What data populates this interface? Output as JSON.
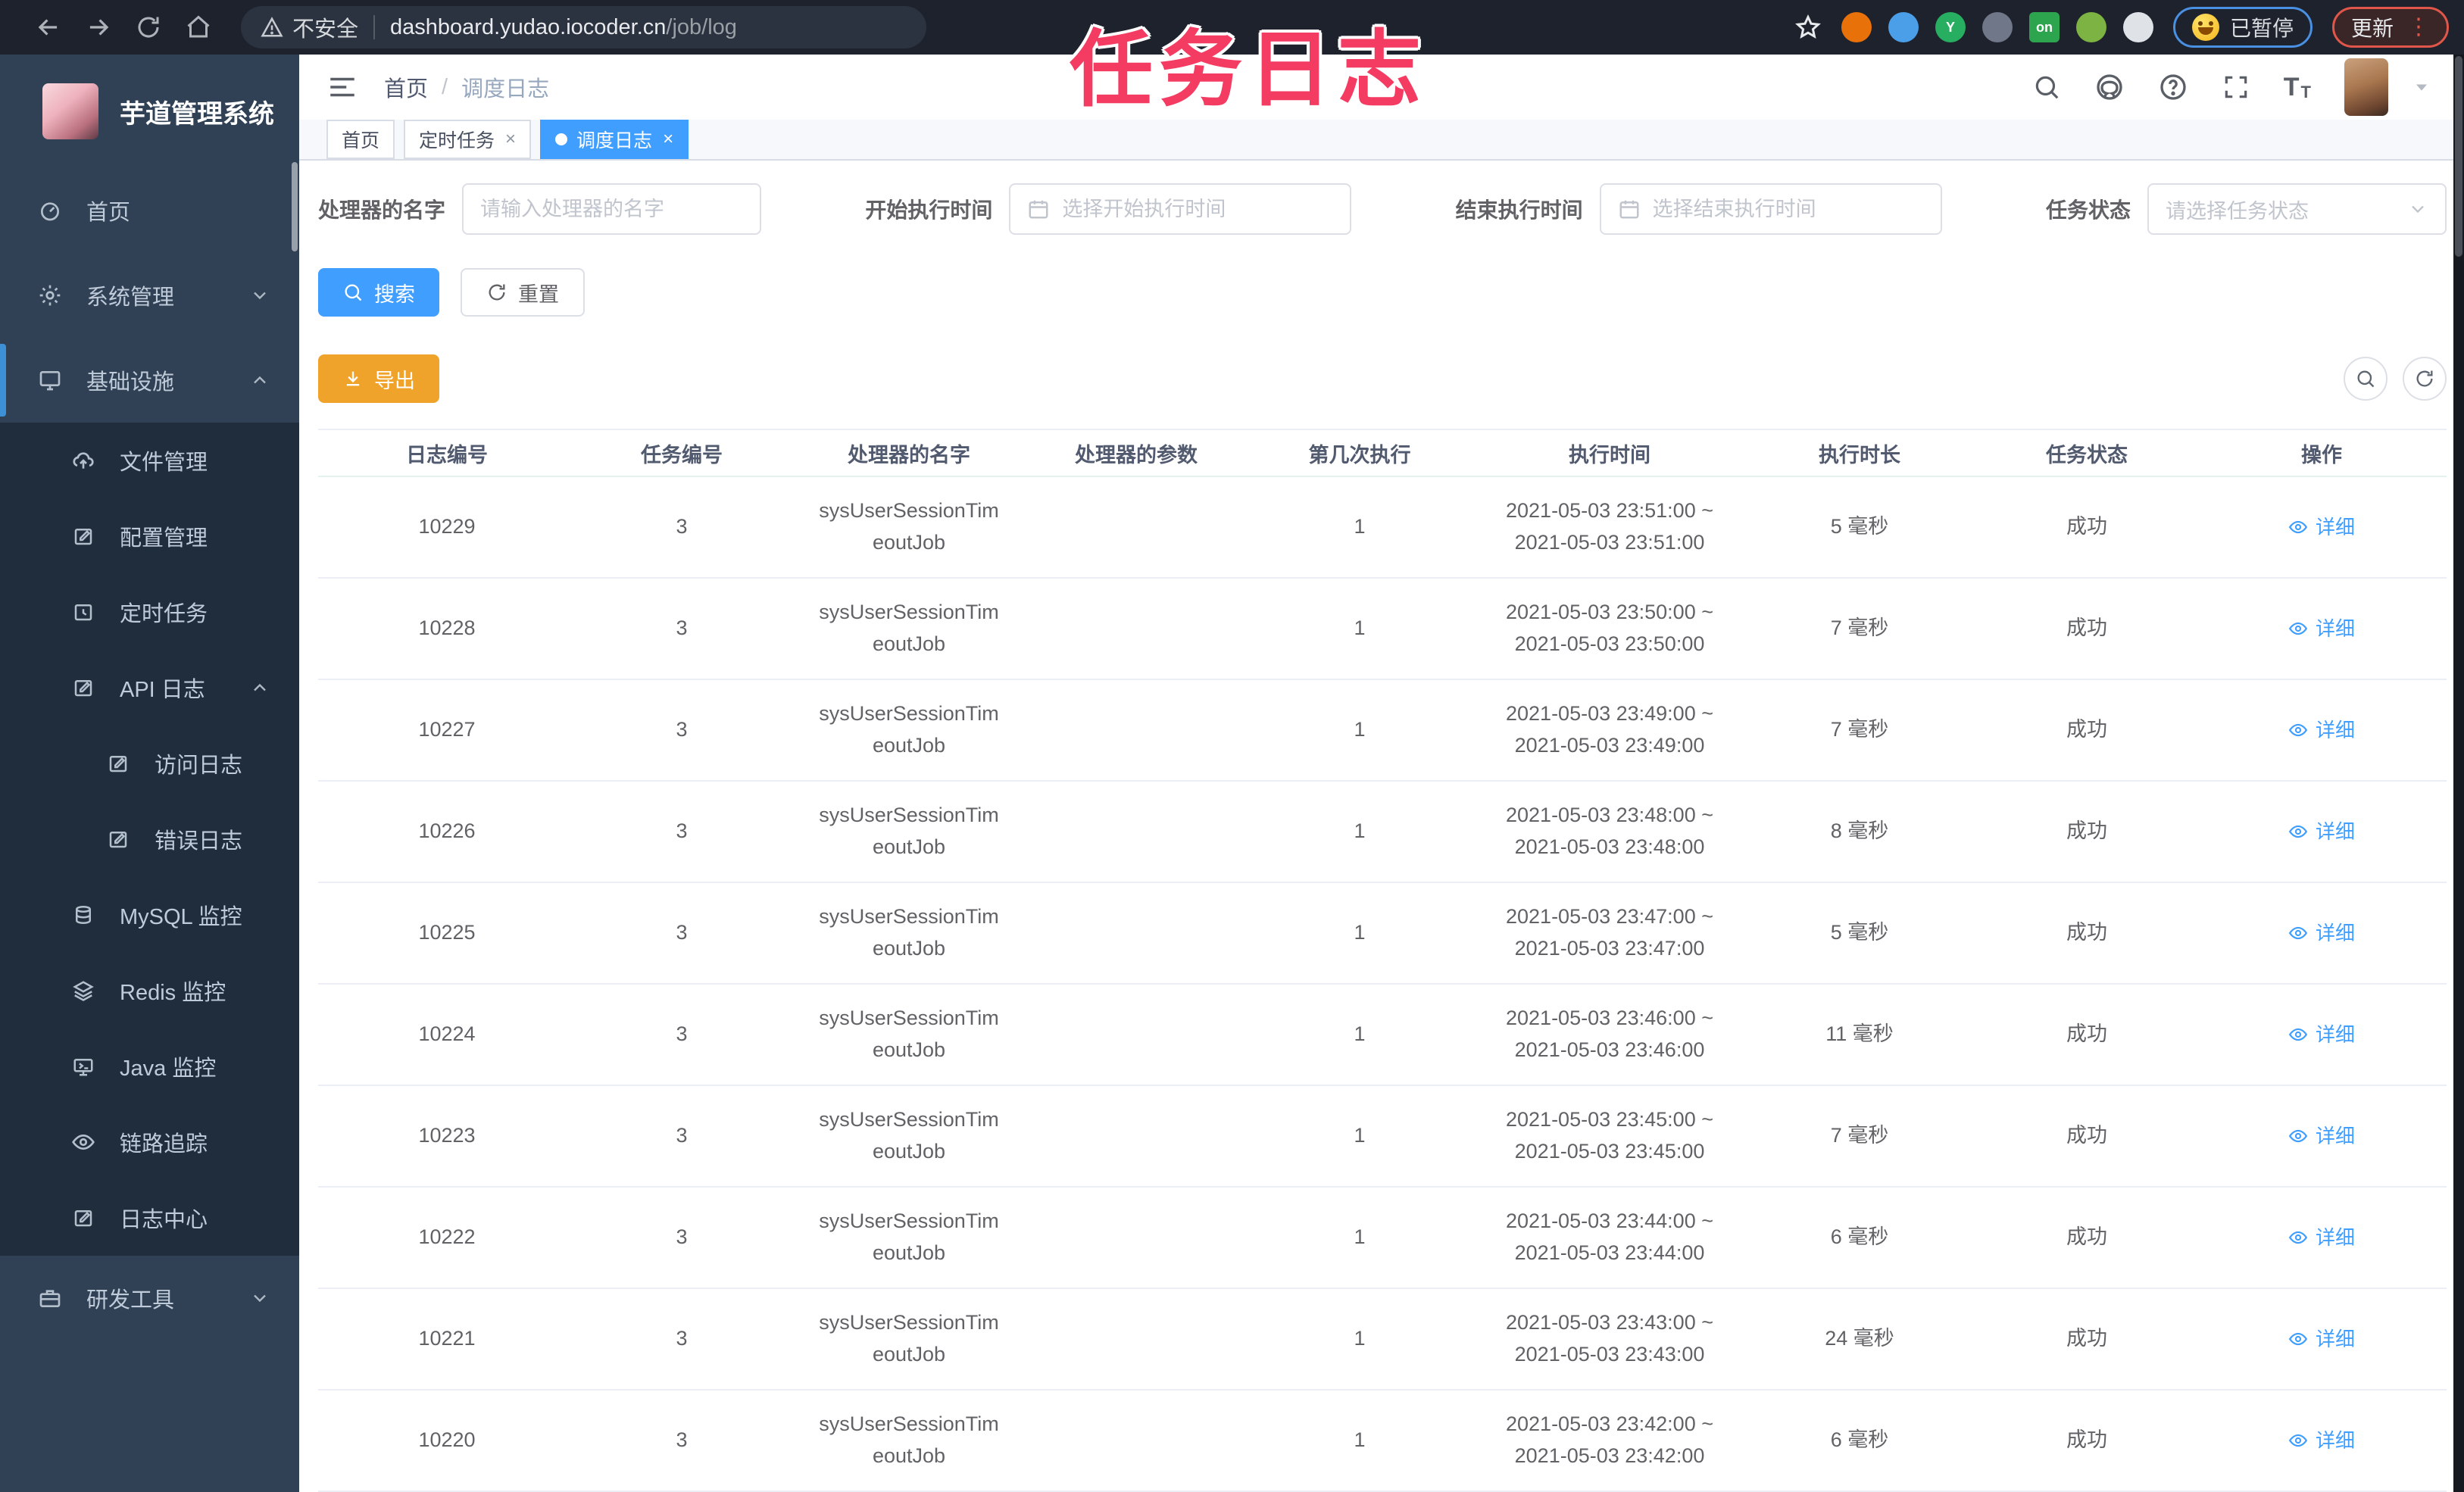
{
  "browser": {
    "security_label": "不安全",
    "url_host": "dashboard.yudao.iocoder.cn",
    "url_path": "/job/log",
    "paused_badge": "已暂停",
    "update_button": "更新",
    "extensions": [
      {
        "name": "extension-orange-icon",
        "color": "#e8710a",
        "glyph": ""
      },
      {
        "name": "extension-blue-lamp-icon",
        "color": "#4a9fe8",
        "glyph": ""
      },
      {
        "name": "extension-green-y-icon",
        "color": "#27ae60",
        "glyph": "Y"
      },
      {
        "name": "extension-grid-icon",
        "color": "#6f7789",
        "glyph": ""
      },
      {
        "name": "extension-on-badge-icon",
        "color": "#2da44e",
        "glyph": "on"
      },
      {
        "name": "extension-leaf-icon",
        "color": "#7cb342",
        "glyph": ""
      },
      {
        "name": "extension-puzzle-icon",
        "color": "#dfe3e8",
        "glyph": ""
      }
    ]
  },
  "overlay": {
    "title": "任务日志"
  },
  "app": {
    "title": "芋道管理系统"
  },
  "breadcrumb": {
    "home": "首页",
    "separator": "/",
    "current": "调度日志"
  },
  "tabs": [
    {
      "label": "首页",
      "active": false,
      "closable": false
    },
    {
      "label": "定时任务",
      "active": false,
      "closable": true
    },
    {
      "label": "调度日志",
      "active": true,
      "closable": true
    }
  ],
  "sidebar": {
    "items": [
      {
        "label": "首页",
        "icon": "dashboard-icon",
        "level": 1
      },
      {
        "label": "系统管理",
        "icon": "gear-icon",
        "level": 1,
        "chevron": "down"
      },
      {
        "label": "基础设施",
        "icon": "monitor-icon",
        "level": 1,
        "chevron": "up",
        "active": true
      },
      {
        "label": "文件管理",
        "icon": "cloud-upload-icon",
        "level": 2,
        "submenu": true
      },
      {
        "label": "配置管理",
        "icon": "edit-icon",
        "level": 2,
        "submenu": true
      },
      {
        "label": "定时任务",
        "icon": "timer-icon",
        "level": 2,
        "submenu": true
      },
      {
        "label": "API 日志",
        "icon": "edit-icon",
        "level": 2,
        "submenu": true,
        "chevron": "up"
      },
      {
        "label": "访问日志",
        "icon": "edit-icon",
        "level": 3,
        "submenu": true
      },
      {
        "label": "错误日志",
        "icon": "edit-icon",
        "level": 3,
        "submenu": true
      },
      {
        "label": "MySQL 监控",
        "icon": "database-icon",
        "level": 2,
        "submenu": true
      },
      {
        "label": "Redis 监控",
        "icon": "layers-icon",
        "level": 2,
        "submenu": true
      },
      {
        "label": "Java 监控",
        "icon": "java-monitor-icon",
        "level": 2,
        "submenu": true
      },
      {
        "label": "链路追踪",
        "icon": "eye-icon",
        "level": 2,
        "submenu": true
      },
      {
        "label": "日志中心",
        "icon": "edit-icon",
        "level": 2,
        "submenu": true
      },
      {
        "label": "研发工具",
        "icon": "toolbox-icon",
        "level": 1,
        "chevron": "down"
      }
    ]
  },
  "filters": {
    "handler": {
      "label": "处理器的名字",
      "placeholder": "请输入处理器的名字"
    },
    "start_time": {
      "label": "开始执行时间",
      "placeholder": "选择开始执行时间"
    },
    "end_time": {
      "label": "结束执行时间",
      "placeholder": "选择结束执行时间"
    },
    "status": {
      "label": "任务状态",
      "placeholder": "请选择任务状态"
    }
  },
  "actions": {
    "search": "搜索",
    "reset": "重置",
    "export": "导出"
  },
  "table": {
    "headers": [
      "日志编号",
      "任务编号",
      "处理器的名字",
      "处理器的参数",
      "第几次执行",
      "执行时间",
      "执行时长",
      "任务状态",
      "操作"
    ],
    "action_label": "详细",
    "rows": [
      {
        "log_id": "10229",
        "job_id": "3",
        "handler": [
          "sysUserSessionTim",
          "eoutJob"
        ],
        "param": "",
        "nth": "1",
        "time": [
          "2021-05-03 23:51:00 ~",
          "2021-05-03 23:51:00"
        ],
        "duration": "5 毫秒",
        "status": "成功"
      },
      {
        "log_id": "10228",
        "job_id": "3",
        "handler": [
          "sysUserSessionTim",
          "eoutJob"
        ],
        "param": "",
        "nth": "1",
        "time": [
          "2021-05-03 23:50:00 ~",
          "2021-05-03 23:50:00"
        ],
        "duration": "7 毫秒",
        "status": "成功"
      },
      {
        "log_id": "10227",
        "job_id": "3",
        "handler": [
          "sysUserSessionTim",
          "eoutJob"
        ],
        "param": "",
        "nth": "1",
        "time": [
          "2021-05-03 23:49:00 ~",
          "2021-05-03 23:49:00"
        ],
        "duration": "7 毫秒",
        "status": "成功"
      },
      {
        "log_id": "10226",
        "job_id": "3",
        "handler": [
          "sysUserSessionTim",
          "eoutJob"
        ],
        "param": "",
        "nth": "1",
        "time": [
          "2021-05-03 23:48:00 ~",
          "2021-05-03 23:48:00"
        ],
        "duration": "8 毫秒",
        "status": "成功"
      },
      {
        "log_id": "10225",
        "job_id": "3",
        "handler": [
          "sysUserSessionTim",
          "eoutJob"
        ],
        "param": "",
        "nth": "1",
        "time": [
          "2021-05-03 23:47:00 ~",
          "2021-05-03 23:47:00"
        ],
        "duration": "5 毫秒",
        "status": "成功"
      },
      {
        "log_id": "10224",
        "job_id": "3",
        "handler": [
          "sysUserSessionTim",
          "eoutJob"
        ],
        "param": "",
        "nth": "1",
        "time": [
          "2021-05-03 23:46:00 ~",
          "2021-05-03 23:46:00"
        ],
        "duration": "11 毫秒",
        "status": "成功"
      },
      {
        "log_id": "10223",
        "job_id": "3",
        "handler": [
          "sysUserSessionTim",
          "eoutJob"
        ],
        "param": "",
        "nth": "1",
        "time": [
          "2021-05-03 23:45:00 ~",
          "2021-05-03 23:45:00"
        ],
        "duration": "7 毫秒",
        "status": "成功"
      },
      {
        "log_id": "10222",
        "job_id": "3",
        "handler": [
          "sysUserSessionTim",
          "eoutJob"
        ],
        "param": "",
        "nth": "1",
        "time": [
          "2021-05-03 23:44:00 ~",
          "2021-05-03 23:44:00"
        ],
        "duration": "6 毫秒",
        "status": "成功"
      },
      {
        "log_id": "10221",
        "job_id": "3",
        "handler": [
          "sysUserSessionTim",
          "eoutJob"
        ],
        "param": "",
        "nth": "1",
        "time": [
          "2021-05-03 23:43:00 ~",
          "2021-05-03 23:43:00"
        ],
        "duration": "24 毫秒",
        "status": "成功"
      },
      {
        "log_id": "10220",
        "job_id": "3",
        "handler": [
          "sysUserSessionTim",
          "eoutJob"
        ],
        "param": "",
        "nth": "1",
        "time": [
          "2021-05-03 23:42:00 ~",
          "2021-05-03 23:42:00"
        ],
        "duration": "6 毫秒",
        "status": "成功"
      }
    ]
  },
  "colors": {
    "primary": "#409eff",
    "warning": "#f0a32a",
    "sidebar_bg": "#304156",
    "submenu_bg": "#1f2d3d",
    "overlay_pink": "#f43b61"
  }
}
